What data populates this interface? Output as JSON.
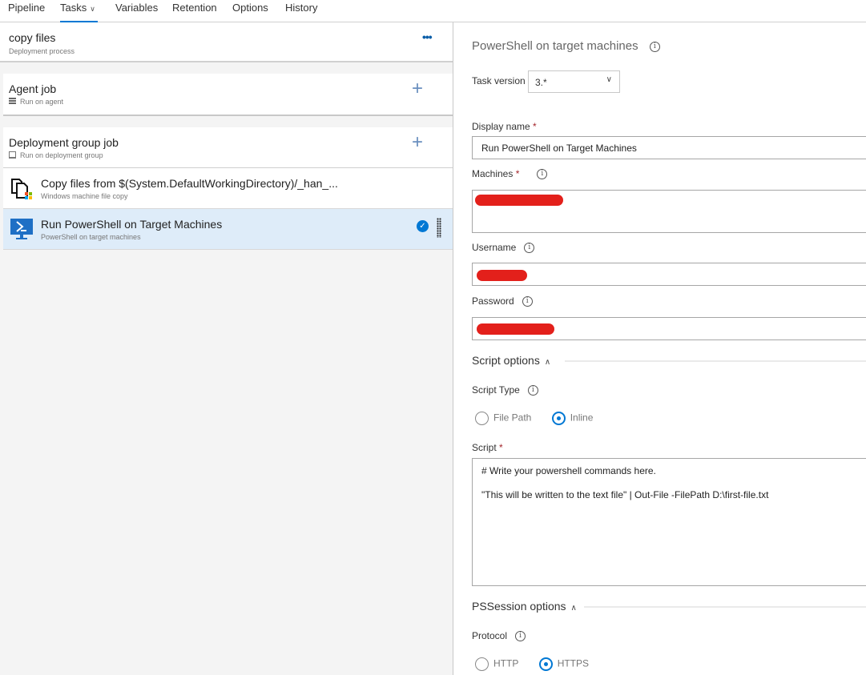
{
  "nav": {
    "tabs": [
      {
        "label": "Pipeline"
      },
      {
        "label": "Tasks",
        "active": true,
        "has_dropdown": true
      },
      {
        "label": "Variables"
      },
      {
        "label": "Retention"
      },
      {
        "label": "Options"
      },
      {
        "label": "History"
      }
    ]
  },
  "process": {
    "title": "copy files",
    "subtitle": "Deployment process",
    "more_icon": "ellipsis-icon"
  },
  "jobs": [
    {
      "title": "Agent job",
      "subtitle": "Run on agent",
      "icon": "agent-server-icon",
      "add_icon": "plus-icon"
    },
    {
      "title": "Deployment group job",
      "subtitle": "Run on deployment group",
      "icon": "deployment-group-icon",
      "add_icon": "plus-icon"
    }
  ],
  "tasks": [
    {
      "title": "Copy files from $(System.DefaultWorkingDirectory)/_han_...",
      "subtitle": "Windows machine file copy",
      "icon": "file-copy-icon",
      "selected": false
    },
    {
      "title": "Run PowerShell on Target Machines",
      "subtitle": "PowerShell on target machines",
      "icon": "powershell-icon",
      "selected": true,
      "status_icon": "checkmark-circle-icon",
      "accent": "#0078d4"
    }
  ],
  "panel": {
    "title": "PowerShell on target machines",
    "task_version_label": "Task version",
    "task_version_value": "3.*",
    "display_name_label": "Display name",
    "display_name_value": "Run PowerShell on Target Machines",
    "machines_label": "Machines",
    "username_label": "Username",
    "password_label": "Password",
    "required_marker": "*",
    "redaction_color": "#e3201b",
    "script_options": {
      "header": "Script options",
      "script_type_label": "Script Type",
      "options": [
        "File Path",
        "Inline"
      ],
      "selected": "Inline",
      "script_label": "Script",
      "script_lines": [
        "# Write your powershell commands here.",
        "\"This will be written to the text file\" | Out-File -FilePath D:\\first-file.txt"
      ]
    },
    "pssession_options": {
      "header": "PSSession options",
      "protocol_label": "Protocol",
      "options": [
        "HTTP",
        "HTTPS"
      ],
      "selected": "HTTPS"
    }
  }
}
